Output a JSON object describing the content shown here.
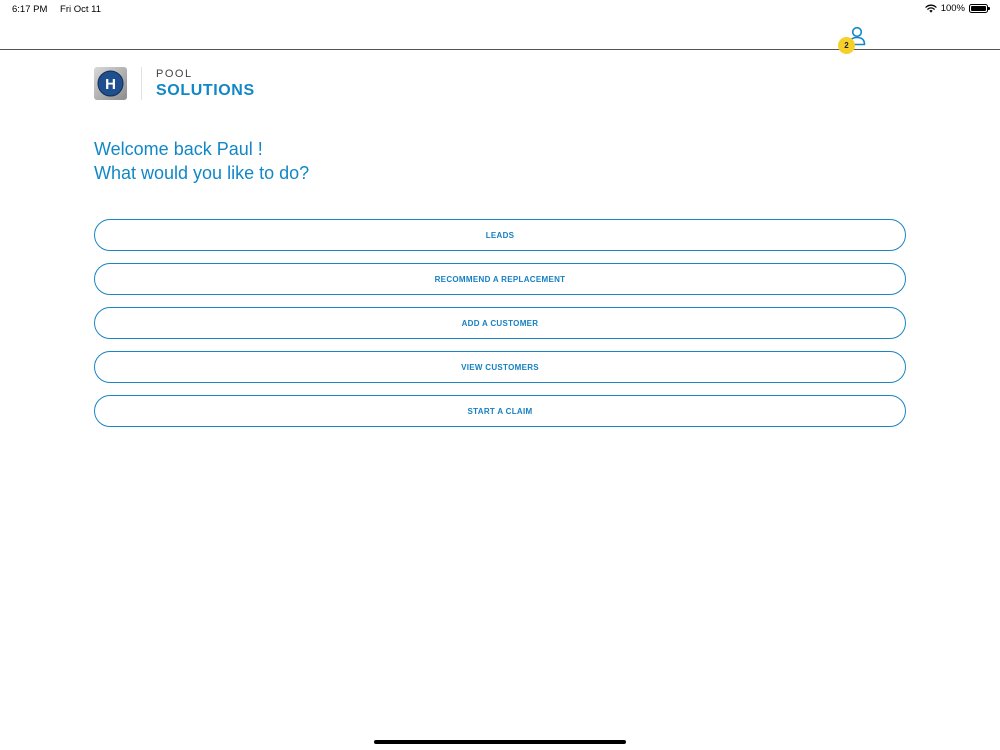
{
  "status_bar": {
    "time": "6:17 PM",
    "date": "Fri Oct 11",
    "battery_text": "100%",
    "battery_level": 1.0,
    "icons": [
      "wifi-icon",
      "battery-icon"
    ]
  },
  "header": {
    "notification_count": "2",
    "user_icon": "user-icon",
    "badge_color": "#f7cf2a"
  },
  "brand": {
    "logo_letter": "H",
    "top_text": "POOL",
    "bottom_text": "SOLUTIONS",
    "accent_color": "#1287c8"
  },
  "welcome": {
    "line1": "Welcome back Paul !",
    "line2": "What would you like to do?"
  },
  "actions": [
    {
      "label": "LEADS"
    },
    {
      "label": "RECOMMEND A REPLACEMENT"
    },
    {
      "label": "ADD A CUSTOMER"
    },
    {
      "label": "VIEW CUSTOMERS"
    },
    {
      "label": "START A CLAIM"
    }
  ]
}
